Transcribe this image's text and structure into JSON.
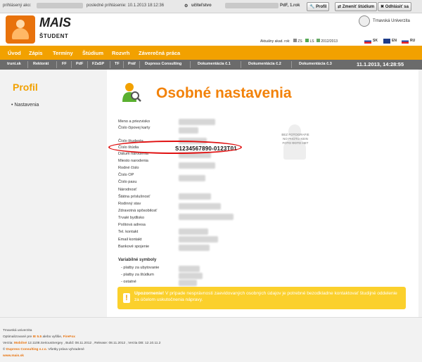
{
  "topbar": {
    "login_label": "prihlásený ako:",
    "last_login_label": "posledné prihlásenie: 10.1.2013 18:12:36",
    "teacher_label": "učiteľstvo",
    "program": "PdF, 1.rok",
    "profile_btn": "Profil",
    "change_study_btn": "Zmeniť štúdium",
    "logout_btn": "Odhlásiť sa"
  },
  "header": {
    "app_name": "MAIS",
    "subtitle": "ŠTUDENT",
    "university": "Trnavská Univerzita",
    "akad_label": "Aktuálny akad. rok:",
    "zs": "ZS",
    "ls": "LS",
    "year": "2012/2013",
    "langs": [
      "SK",
      "EN",
      "RU"
    ]
  },
  "menu": [
    "Úvod",
    "Zápis",
    "Termíny",
    "Štúdium",
    "Rozvrh",
    "Záverečná práca"
  ],
  "links": [
    "truni.sk",
    "Rektorát",
    "FF",
    "PdF",
    "FZaSP",
    "TF",
    "Práf",
    "Dupress Consulting",
    "Dokumentácia č.1",
    "Dokumentácia č.2",
    "Dokumentácia č.3"
  ],
  "datetime": "11.1.2013,  14:28:55",
  "sidebar": {
    "title": "Profil",
    "item": "• Nastavenia"
  },
  "main": {
    "title": "Osobné nastavenia",
    "fields": [
      "Meno a priezvisko",
      "Číslo čipovej karty",
      "Číslo študenta",
      "Číslo štúdia",
      "Dátum narodenia",
      "Miesto narodenia",
      "Rodné číslo",
      "Číslo OP",
      "Číslo pasu",
      "Národnosť",
      "Štátna príslušnosť",
      "Rodinný stav",
      "Zdravotná spôsobilosť",
      "Trvalé bydlisko",
      "Poštová adresa",
      "Tel. kontakt",
      "Email kontakt",
      "Bankové spojenie"
    ],
    "student_id": "S1234567890-0123T01",
    "var_title": "Variabilné symboly",
    "var_fields": [
      "- platby za ubytovanie",
      "- platby za štúdium",
      "- ostatné"
    ],
    "photo_text": "BEZ FOTOGRAFIE NO PHOTO KEIN FOTO ФОТО НЕТ",
    "warning_strong": "Upozornenie!",
    "warning_text": " V prípade nesprávnosti zaevidovaných osobných údajov je potrebné bezodkladne kontaktovať študijné oddelenie za účelom uskutočnenia nápravy."
  },
  "footer": {
    "line1": "Trnavská univerzita",
    "line2a": "Optimalizované pre ",
    "ie": "IE 5.5",
    "line2b": " alebo vyššie, ",
    "ff": "FireFox",
    "line3a": "Verzia: ",
    "mobilne": "Mobilné",
    "line3b": " 12.1108.SeriousSergey , Build: 08.11.2012 , Release: 08.11.2012 , Verzia DB: 12.10.11.2",
    "copy_a": "© ",
    "dupress": "Dupress Consulting s.r.o.",
    "copy_b": " Všetky práva vyhradené",
    "site": "www.mais.sk"
  },
  "colors": {
    "accent": "#f2a100",
    "title": "#f2820a",
    "oval": "#e01010",
    "warning": "#fbd02c"
  }
}
